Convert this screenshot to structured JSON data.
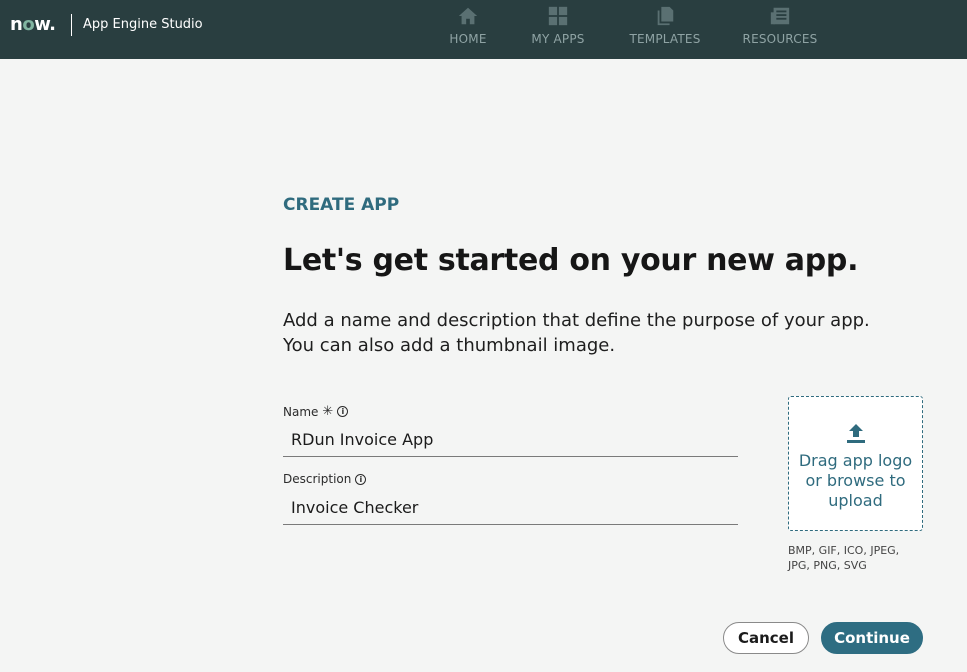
{
  "header": {
    "logo_text": "now.",
    "app_title": "App Engine Studio",
    "nav": [
      {
        "label": "HOME",
        "icon": "home-icon"
      },
      {
        "label": "MY APPS",
        "icon": "grid-icon"
      },
      {
        "label": "TEMPLATES",
        "icon": "copy-icon"
      },
      {
        "label": "RESOURCES",
        "icon": "newspaper-icon"
      }
    ]
  },
  "main": {
    "eyebrow": "CREATE APP",
    "headline": "Let's get started on your new app.",
    "intro_line1": "Add a name and description that define the purpose of your app.",
    "intro_line2": "You can also add a thumbnail image.",
    "name_label": "Name",
    "required_mark": "✳",
    "name_value": "RDun Invoice App",
    "description_label": "Description",
    "description_value": "Invoice Checker",
    "upload_text": "Drag app logo or browse to upload",
    "formats": "BMP, GIF, ICO, JPEG, JPG, PNG, SVG",
    "cancel_label": "Cancel",
    "continue_label": "Continue"
  },
  "colors": {
    "header_bg": "#293e40",
    "accent": "#2f6b7e",
    "page_bg": "#f4f5f4"
  }
}
